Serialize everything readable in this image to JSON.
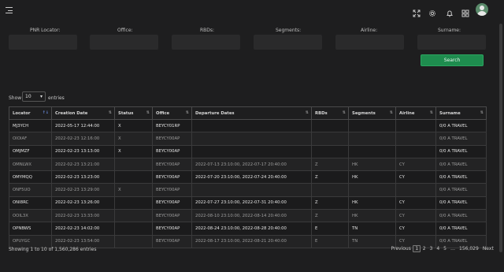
{
  "filters": {
    "pnr_locator": {
      "label": "PNR Locator:",
      "value": ""
    },
    "office": {
      "label": "Office:",
      "value": ""
    },
    "rbds": {
      "label": "RBDs:",
      "value": ""
    },
    "segments": {
      "label": "Segments:",
      "value": ""
    },
    "airline": {
      "label": "Airline:",
      "value": ""
    },
    "surname": {
      "label": "Surname:",
      "value": ""
    },
    "search_label": "Search"
  },
  "length": {
    "show": "Show",
    "value": "10",
    "entries": "entries"
  },
  "table": {
    "headers": [
      "Locator",
      "Creation Date",
      "Status",
      "Office",
      "Departure Dates",
      "RBDs",
      "Segments",
      "Airline",
      "Surname"
    ],
    "rows": [
      [
        "MJ3YCH",
        "2022-05-17 12:44:00",
        "X",
        "BEYCY01RP",
        "",
        "",
        "",
        "",
        "0/0 A TRAVEL"
      ],
      [
        "OIOIAF",
        "2022-02-23 12:16:00",
        "X",
        "BEYCY00AP",
        "",
        "",
        "",
        "",
        "0/0 A TRAVEL"
      ],
      [
        "OMJMZF",
        "2022-02-23 13:13:00",
        "X",
        "BEYCY00AP",
        "",
        "",
        "",
        "",
        "0/0 A TRAVEL"
      ],
      [
        "OMNLWX",
        "2022-02-23 13:21:00",
        "",
        "BEYCY00AP",
        "2022-07-13 23:10:00, 2022-07-17 20:40:00",
        "Z",
        "HK",
        "CY",
        "0/0 A TRAVEL"
      ],
      [
        "OMYMQQ",
        "2022-02-23 13:23:00",
        "",
        "BEYCY00AP",
        "2022-07-20 23:10:00, 2022-07-24 20:40:00",
        "Z",
        "HK",
        "CY",
        "0/0 A TRAVEL"
      ],
      [
        "ONF5UO",
        "2022-02-23 13:29:00",
        "X",
        "BEYCY00AP",
        "",
        "",
        "",
        "",
        "0/0 A TRAVEL"
      ],
      [
        "ONI8RC",
        "2022-02-23 13:26:00",
        "",
        "BEYCY00AP",
        "2022-07-27 23:10:00, 2022-07-31 20:40:00",
        "Z",
        "HK",
        "CY",
        "0/0 A TRAVEL"
      ],
      [
        "OOIL3X",
        "2022-02-23 13:33:00",
        "",
        "BEYCY00AP",
        "2022-08-10 23:10:00, 2022-08-14 20:40:00",
        "Z",
        "HK",
        "CY",
        "0/0 A TRAVEL"
      ],
      [
        "OPNBWS",
        "2022-02-23 14:02:00",
        "",
        "BEYCY00AP",
        "2022-08-24 23:10:00, 2022-08-28 20:40:00",
        "E",
        "TN",
        "CY",
        "0/0 A TRAVEL"
      ],
      [
        "OPUYGC",
        "2022-02-23 13:54:00",
        "",
        "BEYCY00AP",
        "2022-08-17 23:10:00, 2022-08-21 20:40:00",
        "E",
        "TN",
        "CY",
        "0/0 A TRAVEL"
      ]
    ]
  },
  "info": "Showing 1 to 10 of 1,560,286 entries",
  "pager": {
    "previous": "Previous",
    "pages": [
      "1",
      "2",
      "3",
      "4",
      "5",
      "…",
      "156,029"
    ],
    "next": "Next"
  },
  "colors": {
    "accent": "#1e8c4e",
    "background": "#1e1e1f"
  },
  "icons": [
    "menu-icon",
    "fullscreen-icon",
    "settings-icon",
    "notification-icon",
    "apps-grid-icon",
    "avatar"
  ]
}
